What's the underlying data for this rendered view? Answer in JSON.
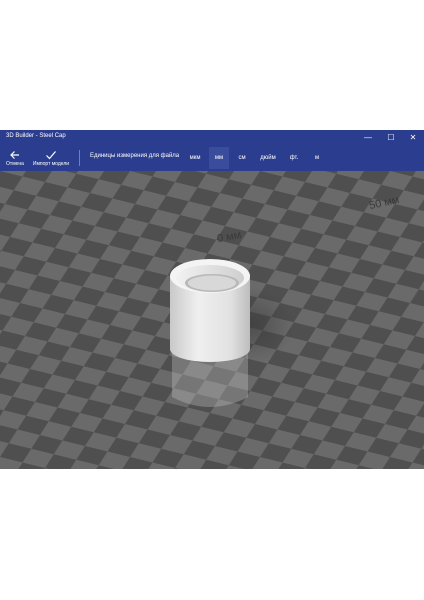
{
  "window": {
    "title": "3D Builder - Steel Cap",
    "controls": {
      "minimize": "—",
      "maximize": "☐",
      "close": "✕"
    }
  },
  "toolbar": {
    "cancel_label": "Отмена",
    "import_label": "Импорт модели",
    "units_label": "Единицы измерения для файла",
    "units": [
      {
        "label": "мкм",
        "selected": false
      },
      {
        "label": "мм",
        "selected": true
      },
      {
        "label": "см",
        "selected": false
      },
      {
        "label": "дюйм",
        "selected": false
      },
      {
        "label": "фт.",
        "selected": false
      },
      {
        "label": "м",
        "selected": false
      }
    ]
  },
  "viewport": {
    "ruler_labels": [
      "50 мм",
      "0 мм"
    ]
  }
}
